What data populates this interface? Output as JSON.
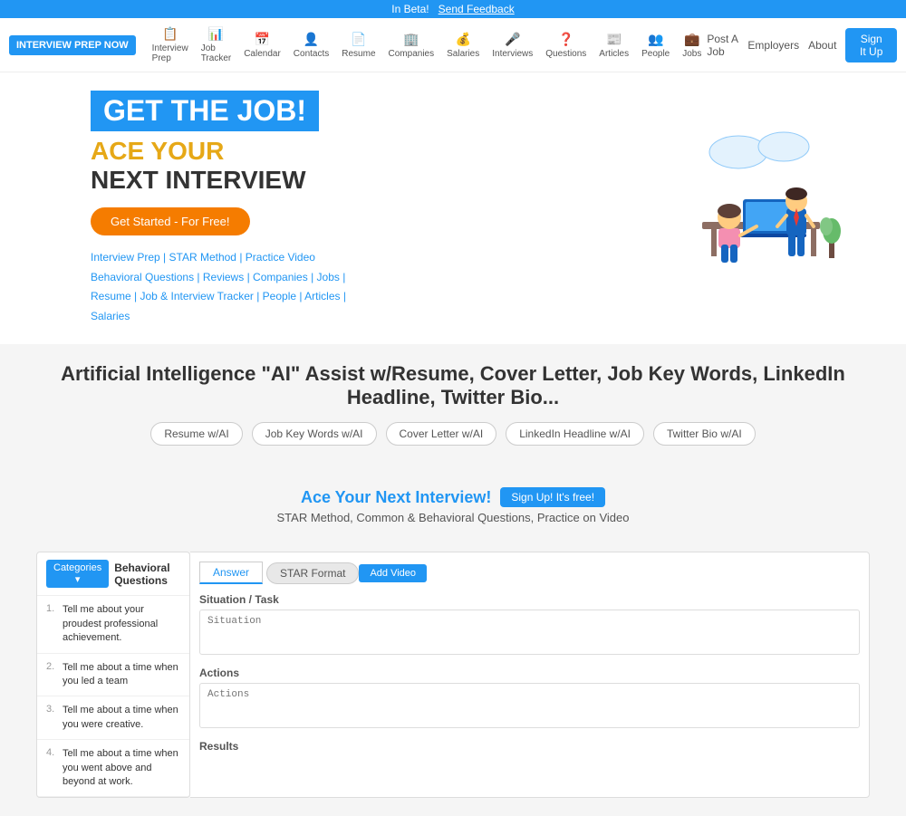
{
  "beta_bar": {
    "text": "In Beta!",
    "link_text": "Send Feedback"
  },
  "nav": {
    "logo": "INTERVIEW PREP NOW",
    "items": [
      {
        "label": "Interview Prep",
        "icon": "📋"
      },
      {
        "label": "Job Tracker",
        "icon": "📊"
      },
      {
        "label": "Calendar",
        "icon": "📅"
      },
      {
        "label": "Contacts",
        "icon": "👤"
      },
      {
        "label": "Resume",
        "icon": "📄"
      },
      {
        "label": "Companies",
        "icon": "🏢"
      },
      {
        "label": "Salaries",
        "icon": "💰"
      },
      {
        "label": "Interviews",
        "icon": "🎤"
      },
      {
        "label": "Questions",
        "icon": "❓"
      },
      {
        "label": "Articles",
        "icon": "📰"
      },
      {
        "label": "People",
        "icon": "👥"
      },
      {
        "label": "Jobs",
        "icon": "💼"
      }
    ],
    "right_links": [
      "About",
      "Employers",
      "Post A Job"
    ],
    "signup_label": "Sign It Up"
  },
  "hero": {
    "headline": "GET THE JOB!",
    "sub1": "ACE YOUR",
    "sub2": "NEXT INTERVIEW",
    "cta_button": "Get Started - For Free!",
    "links_line1": "Interview Prep | STAR Method | Practice Video",
    "links_line2": "Behavioral Questions | Reviews | Companies | Jobs |",
    "links_line3": "Resume | Job & Interview Tracker | People | Articles |",
    "links_line4": "Salaries"
  },
  "ai_section": {
    "title": "Artificial Intelligence \"AI\" Assist w/Resume, Cover Letter, Job Key Words, LinkedIn Headline, Twitter Bio...",
    "tabs": [
      "Resume w/AI",
      "Job Key Words w/AI",
      "Cover Letter w/AI",
      "LinkedIn Headline w/AI",
      "Twitter Bio w/AI"
    ]
  },
  "interview_section": {
    "title": "Ace Your Next Interview!",
    "signup_btn": "Sign Up! It's free!",
    "subtitle": "STAR Method, Common & Behavioral Questions, Practice on Video"
  },
  "questions_panel": {
    "categories_btn": "Categories ▾",
    "title": "Behavioral Questions",
    "items": [
      {
        "num": "1.",
        "text": "Tell me about your proudest professional achievement."
      },
      {
        "num": "2.",
        "text": "Tell me about a time when you led a team"
      },
      {
        "num": "3.",
        "text": "Tell me about a time when you were creative."
      },
      {
        "num": "4.",
        "text": "Tell me about a time when you went above and beyond at work."
      }
    ]
  },
  "answer_panel": {
    "tab_answer": "Answer",
    "tab_star": "STAR Format",
    "add_video_btn": "Add Video",
    "fields": [
      {
        "label": "Situation / Task",
        "placeholder": "Situation"
      },
      {
        "label": "Actions",
        "placeholder": "Actions"
      },
      {
        "label": "Results",
        "placeholder": ""
      }
    ]
  }
}
